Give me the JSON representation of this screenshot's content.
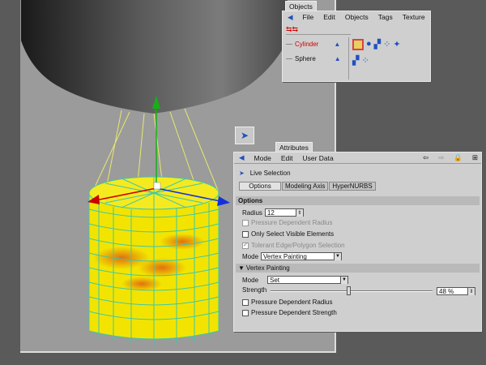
{
  "objects_panel": {
    "tab": "Objects",
    "menu": [
      "File",
      "Edit",
      "Objects",
      "Tags",
      "Texture"
    ],
    "items": [
      {
        "name": "Cylinder",
        "color": "#cc0000"
      },
      {
        "name": "Sphere",
        "color": "#000000"
      }
    ]
  },
  "attributes_panel": {
    "tab": "Attributes",
    "menu": [
      "Mode",
      "Edit",
      "User Data"
    ],
    "tool_name": "Live Selection",
    "tabs": [
      "Options",
      "Modeling Axis",
      "HyperNURBS"
    ],
    "active_tab": "Options",
    "options_header": "Options",
    "radius_label": "Radius",
    "radius_value": "12",
    "pressure_radius": "Pressure Dependent Radius",
    "only_visible": "Only Select Visible Elements",
    "tolerant": "Tolerant Edge/Polygon Selection",
    "mode_label": "Mode",
    "mode_value": "Vertex Painting",
    "vp_header": "Vertex Painting",
    "vp_mode_label": "Mode",
    "vp_mode_value": "Set",
    "strength_label": "Strength",
    "strength_value": "48 %",
    "strength_fraction": 0.48,
    "vp_pressure_radius": "Pressure Dependent Radius",
    "vp_pressure_strength": "Pressure Dependent Strength"
  },
  "colors": {
    "cylinder_yellow": "#f2e400",
    "paint_orange": "#e07a10",
    "wire": "#3ec8a8",
    "viewport": "#9b9b9b",
    "panel": "#cfcfcf"
  }
}
